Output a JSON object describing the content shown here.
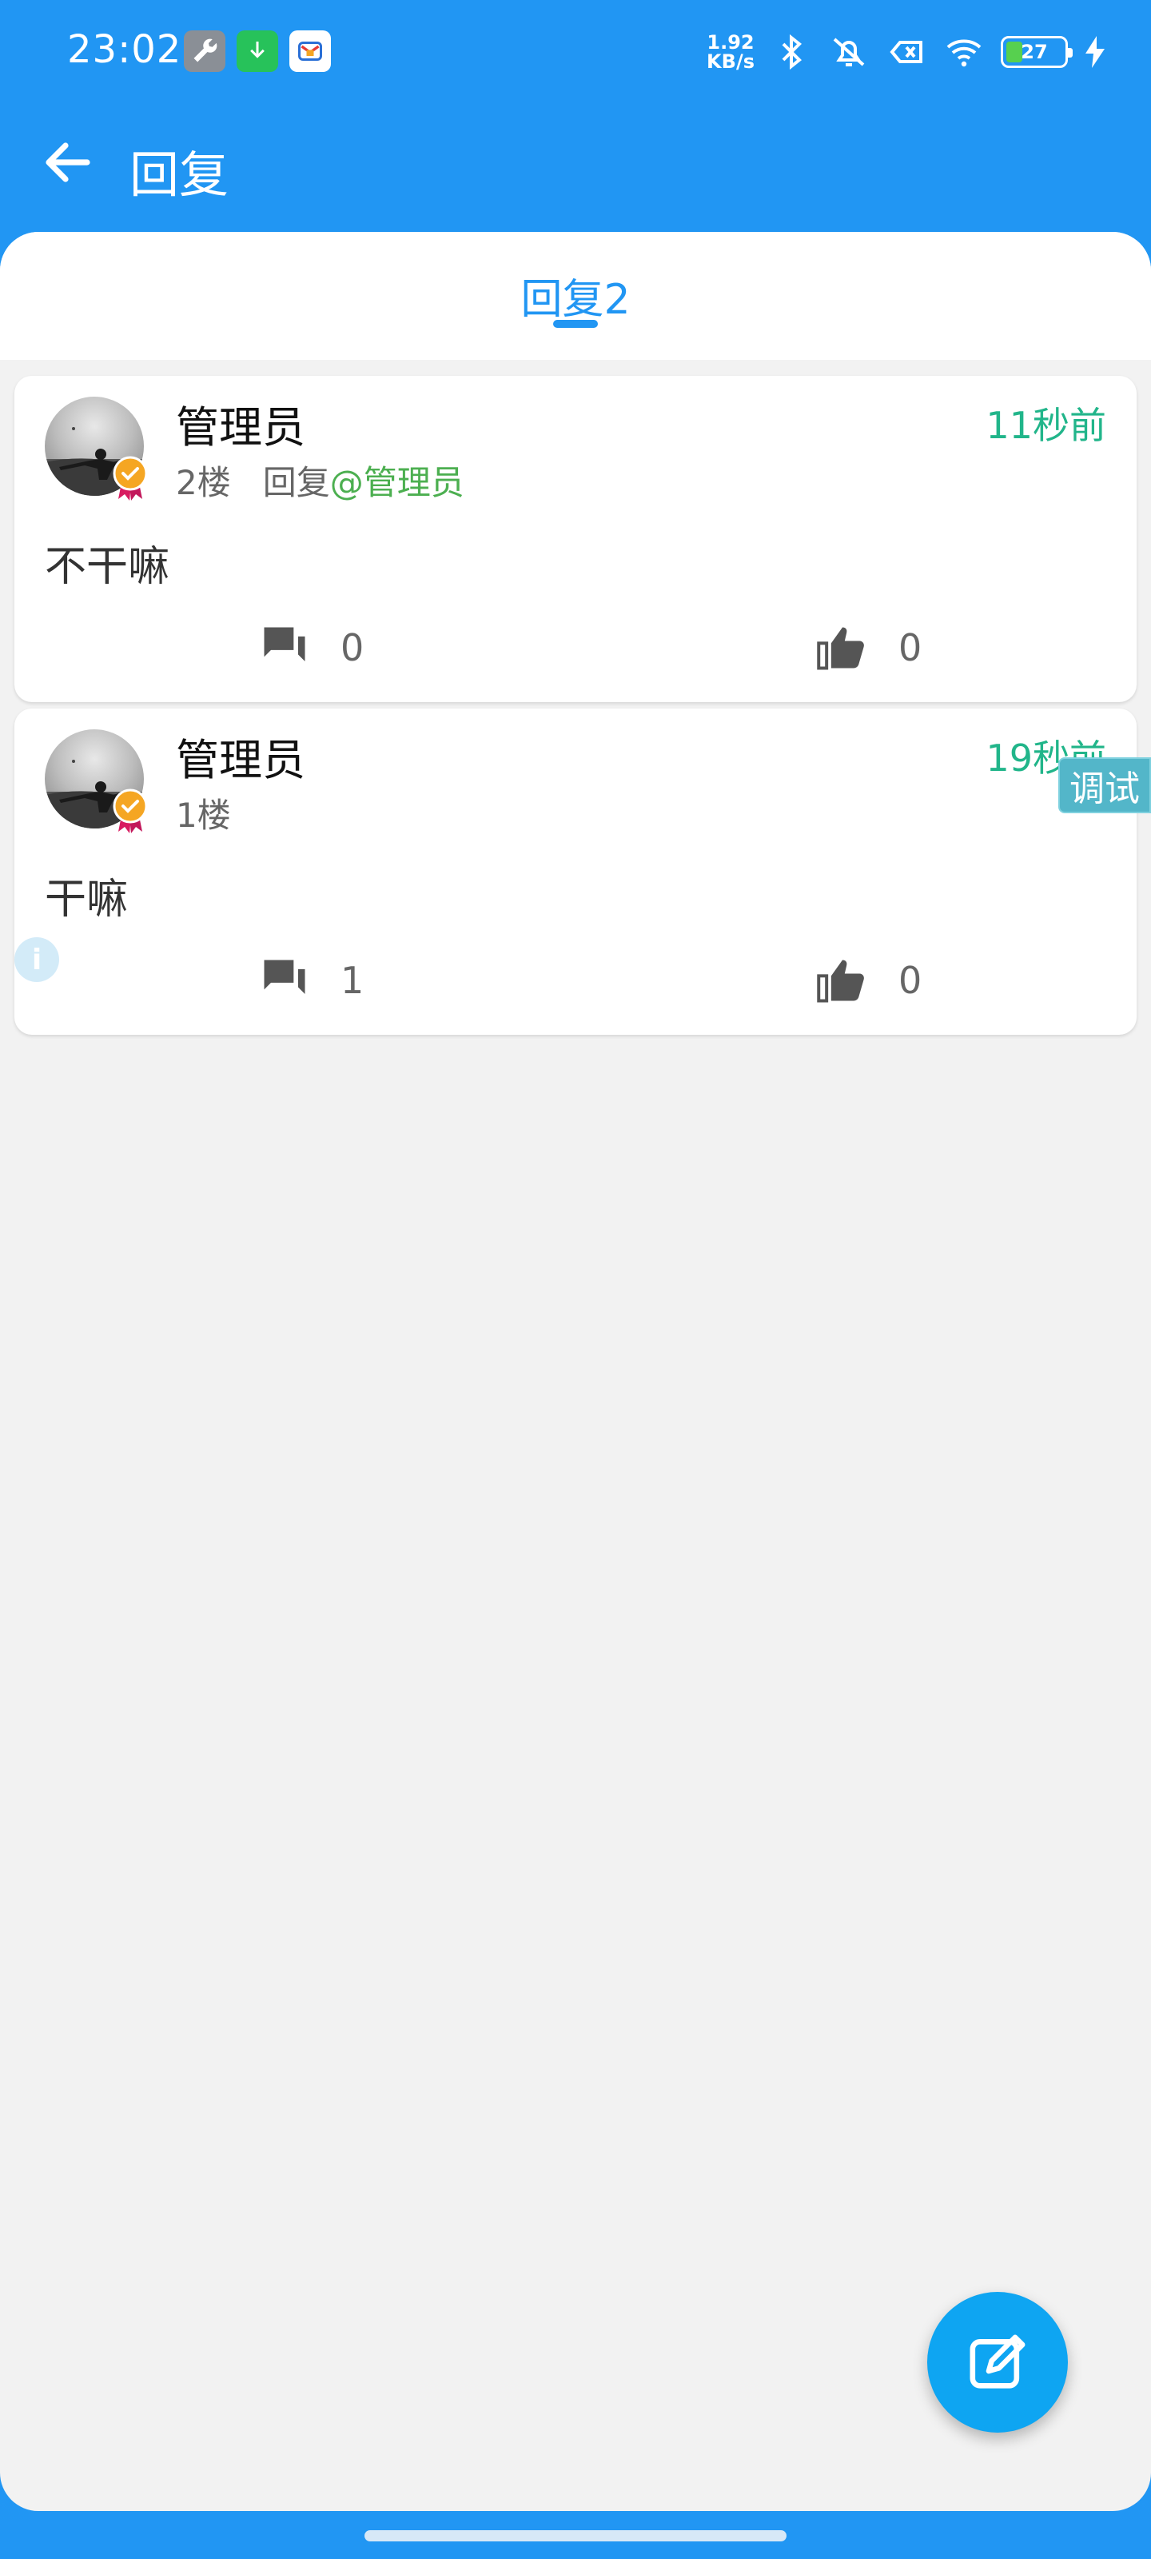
{
  "status_bar": {
    "time": "23:02",
    "net_speed_value": "1.92",
    "net_speed_unit": "KB/s",
    "battery": "27",
    "app_icons": [
      "wrench-icon",
      "download-icon",
      "mail-icon"
    ],
    "status_icons": [
      "bluetooth-icon",
      "vibrate-off-icon",
      "sim-error-icon",
      "wifi-icon",
      "charging-bolt-icon"
    ]
  },
  "app_bar": {
    "title": "回复",
    "back_icon": "arrow-left-icon"
  },
  "tabs": [
    {
      "label": "回复2",
      "active": true
    }
  ],
  "replies": [
    {
      "user": "管理员",
      "floor": "2楼",
      "reply_prefix": "回复",
      "mention": "@管理员",
      "time": "11秒前",
      "text": "不干嘛",
      "comment_count": "0",
      "like_count": "0"
    },
    {
      "user": "管理员",
      "floor": "1楼",
      "reply_prefix": "",
      "mention": "",
      "time": "19秒前",
      "text": "干嘛",
      "comment_count": "1",
      "like_count": "0"
    }
  ],
  "debug_label": "调试",
  "fab_icon": "edit-icon",
  "colors": {
    "primary": "#2196F3",
    "timestamp": "#21b58a",
    "mention": "#4CAF50",
    "fab": "#0EA5F2",
    "background": "#f2f2f2"
  }
}
